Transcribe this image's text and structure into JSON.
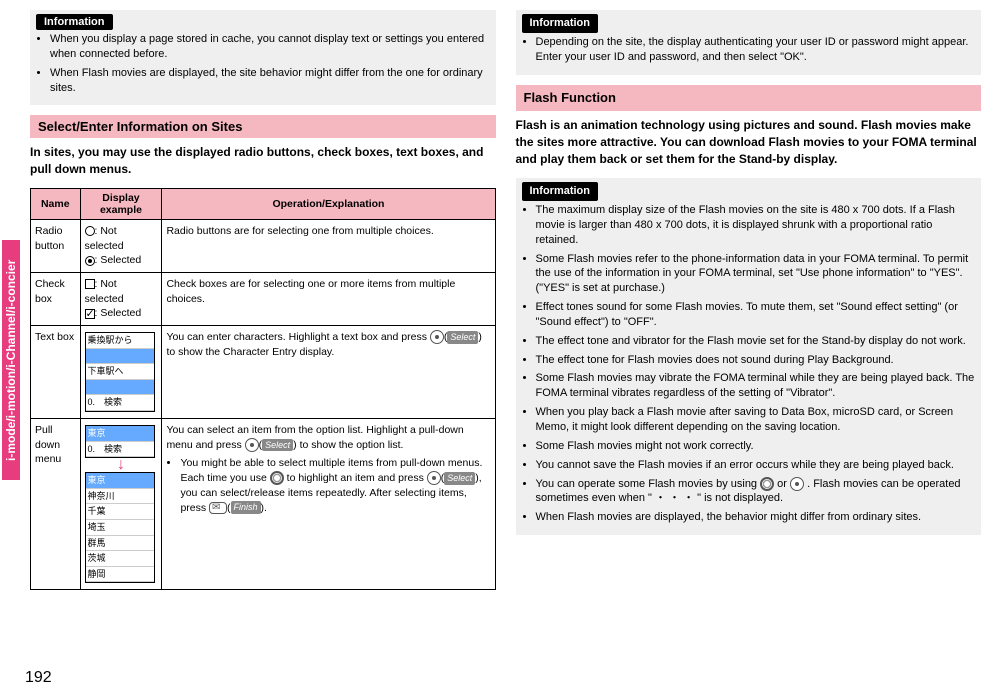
{
  "sideTab": "i-mode/i-motion/i-Channel/i-concier",
  "pageNumber": "192",
  "left": {
    "infoHeader": "Information",
    "infoItems": [
      "When you display a page stored in cache, you cannot display text or settings you entered when connected before.",
      "When Flash movies are displayed, the site behavior might differ from the one for ordinary sites."
    ],
    "sectionTitle": "Select/Enter Information on Sites",
    "intro": "In sites, you may use the displayed radio buttons, check boxes, text boxes, and pull down menus.",
    "table": {
      "headers": {
        "name": "Name",
        "display": "Display example",
        "operation": "Operation/Explanation"
      },
      "radio": {
        "name": "Radio button",
        "notSelected": ": Not selected",
        "selected": ": Selected",
        "op": "Radio buttons are for selecting one from multiple choices."
      },
      "check": {
        "name": "Check box",
        "notSelected": ": Not selected",
        "selected": ": Selected",
        "op": "Check boxes are for selecting one or more items from multiple choices."
      },
      "text": {
        "name": "Text box",
        "opA": "You can enter characters. Highlight a text box and press ",
        "opB": ") to show the Character Entry display.",
        "softSelect": "Select",
        "exLine1": "乗換駅から",
        "exLine2": "下車駅へ",
        "exLine3": "0.　検索"
      },
      "pull": {
        "name": "Pull down menu",
        "opA": "You can select an item from the option list. Highlight a pull-down menu and press ",
        "opB": ") to show the option list.",
        "bulletA1": "You might be able to select multiple items from pull-down menus. Each time you use ",
        "bulletA2": " to highlight an item and press ",
        "bulletA3": "), you can select/release items repeatedly. After selecting items, press ",
        "bulletA4": ").",
        "softSelect": "Select",
        "softFinish": "Finish",
        "exTopLine1": "東京",
        "exTopLine2": "0.　検索",
        "exList": [
          "東京",
          "神奈川",
          "千葉",
          "埼玉",
          "群馬",
          "茨城",
          "静岡"
        ]
      }
    }
  },
  "right": {
    "infoHeader1": "Information",
    "infoItems1A": "Depending on the site, the display authenticating your user ID or password might appear.",
    "infoItems1B": "Enter your user ID and password, and then select \"OK\".",
    "sectionTitle": "Flash Function",
    "body": "Flash is an animation technology using pictures and sound. Flash movies make the sites more attractive. You can download Flash movies to your FOMA terminal and play them back or set them for the Stand-by display.",
    "infoHeader2": "Information",
    "infoItems2": [
      "The maximum display size of the Flash movies on the site is 480 x 700 dots. If a Flash movie is larger than 480 x 700 dots, it is displayed shrunk with a proportional ratio retained.",
      "Some Flash movies refer to the phone-information data in your FOMA terminal. To permit the use of the information in your FOMA terminal, set \"Use phone information\" to \"YES\". (\"YES\" is set at purchase.)",
      "Effect tones sound for some Flash movies. To mute them, set \"Sound effect setting\" (or \"Sound effect\") to \"OFF\".",
      "The effect tone and vibrator for the Flash movie set for the Stand-by display do not work.",
      "The effect tone for Flash movies does not sound during Play Background.",
      "Some Flash movies may vibrate the FOMA terminal while they are being played back. The FOMA terminal vibrates regardless of the setting of \"Vibrator\".",
      "When you play back a Flash movie after saving to Data Box, microSD card, or Screen Memo, it might look different depending on the saving location.",
      "Some Flash movies might not work correctly.",
      "You cannot save the Flash movies if an error occurs while they are being played back."
    ],
    "note10a": "You can operate some Flash movies by using ",
    "note10b": " or ",
    "note10c": ". Flash movies can be operated sometimes even when \"",
    "note10d": "\" is not displayed.",
    "note11": "When Flash movies are displayed, the behavior might differ from ordinary sites."
  }
}
